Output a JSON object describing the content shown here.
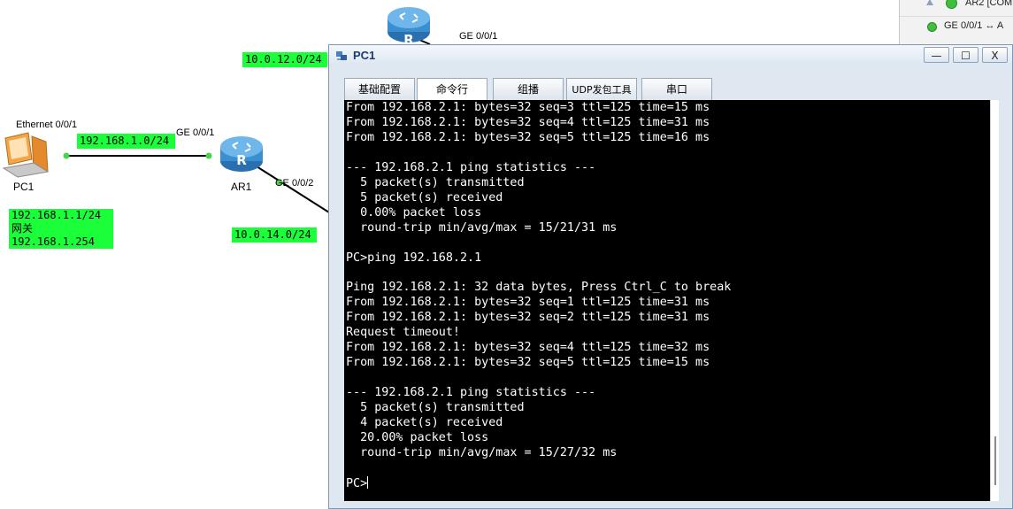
{
  "topology": {
    "network_labels": [
      "10.0.12.0/24",
      "192.168.1.0/24",
      "10.0.14.0/24"
    ],
    "pc1_note": {
      "line1": "192.168.1.1/24",
      "line2": "网关",
      "line3": "192.168.1.254"
    },
    "ports": {
      "pc1_eth": "Ethernet 0/0/1",
      "ar1_ge001": "GE 0/0/1",
      "ar1_ge002": "GE 0/0/2",
      "top_ge001": "GE 0/0/1"
    },
    "devices": {
      "pc1": "PC1",
      "ar1": "AR1"
    },
    "colors": {
      "label_bg": "#1aff3a",
      "router": "#3a8fd0"
    }
  },
  "device_panel": {
    "row1": "AR2 [COM",
    "row2": "GE 0/0/1 ↔ A"
  },
  "window": {
    "title": "PC1",
    "minimize": "—",
    "maximize": "☐",
    "close": "X",
    "tabs": [
      "基础配置",
      "命令行",
      "组播",
      "UDP发包工具",
      "串口"
    ],
    "active_tab": "命令行"
  },
  "terminal": {
    "lines": [
      "From 192.168.2.1: bytes=32 seq=3 ttl=125 time=15 ms",
      "From 192.168.2.1: bytes=32 seq=4 ttl=125 time=31 ms",
      "From 192.168.2.1: bytes=32 seq=5 ttl=125 time=16 ms",
      "",
      "--- 192.168.2.1 ping statistics ---",
      "  5 packet(s) transmitted",
      "  5 packet(s) received",
      "  0.00% packet loss",
      "  round-trip min/avg/max = 15/21/31 ms",
      "",
      "PC>ping 192.168.2.1",
      "",
      "Ping 192.168.2.1: 32 data bytes, Press Ctrl_C to break",
      "From 192.168.2.1: bytes=32 seq=1 ttl=125 time=31 ms",
      "From 192.168.2.1: bytes=32 seq=2 ttl=125 time=31 ms",
      "Request timeout!",
      "From 192.168.2.1: bytes=32 seq=4 ttl=125 time=32 ms",
      "From 192.168.2.1: bytes=32 seq=5 ttl=125 time=15 ms",
      "",
      "--- 192.168.2.1 ping statistics ---",
      "  5 packet(s) transmitted",
      "  4 packet(s) received",
      "  20.00% packet loss",
      "  round-trip min/avg/max = 15/27/32 ms",
      "",
      "PC>"
    ]
  }
}
